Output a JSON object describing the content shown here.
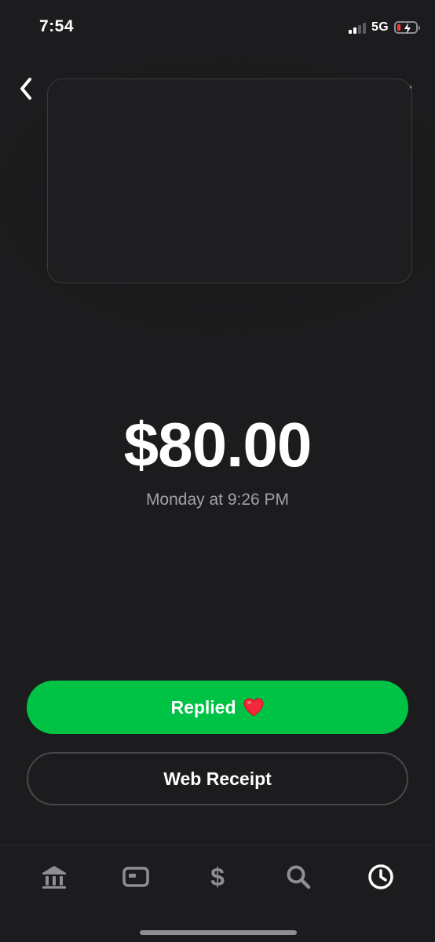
{
  "status_bar": {
    "time": "7:54",
    "network": "5G",
    "battery_color": "#ff3b30"
  },
  "header": {
    "back_icon": "chevron-left-icon",
    "more_icon": "more-icon"
  },
  "payment": {
    "amount": "$80.00",
    "timestamp": "Monday at 9:26 PM"
  },
  "actions": {
    "replied_label": "Replied",
    "replied_emoji_icon": "red-heart-icon",
    "web_receipt_label": "Web Receipt"
  },
  "colors": {
    "background": "#1c1c1e",
    "accent_green": "#00c244",
    "text_secondary": "#a1a1a6"
  },
  "bottom_nav": {
    "items": [
      {
        "icon": "bank-icon",
        "active": false
      },
      {
        "icon": "card-icon",
        "active": false
      },
      {
        "icon": "dollar-icon",
        "active": false
      },
      {
        "icon": "search-icon",
        "active": false
      },
      {
        "icon": "clock-icon",
        "active": true
      }
    ]
  }
}
